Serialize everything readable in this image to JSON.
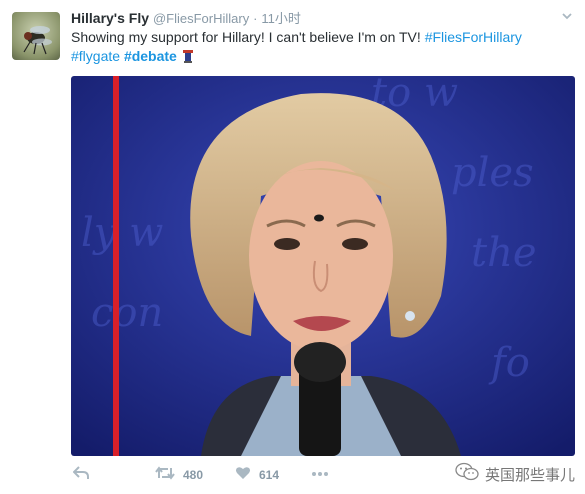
{
  "tweet": {
    "display_name": "Hillary's Fly",
    "handle": "@FliesForHillary",
    "separator": "·",
    "time": "11小时",
    "text_before": "Showing my support for Hillary! I can't believe I'm on TV! ",
    "hashtag_1": "#FliesForHillary",
    "hashtag_2": "#flygate",
    "hashtag_3": "#debate",
    "emoji_name": "podium-icon"
  },
  "actions": {
    "reply_icon": "reply-icon",
    "retweet_icon": "retweet-icon",
    "retweet_count": "480",
    "like_icon": "heart-icon",
    "like_count": "614",
    "more_icon": "more-icon"
  },
  "watermark": {
    "text": "英国那些事儿",
    "icon": "wechat-icon"
  },
  "colors": {
    "hashtag": "#1b95e0",
    "text": "#292f33",
    "muted": "#8899a6",
    "backdrop": "#1f2a8c"
  }
}
